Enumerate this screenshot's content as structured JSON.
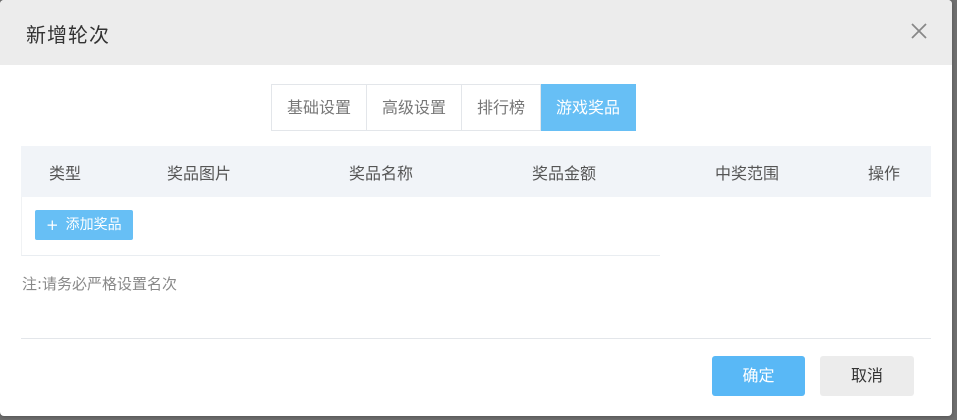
{
  "dialog": {
    "title": "新增轮次"
  },
  "tabs": [
    {
      "label": "基础设置",
      "active": false
    },
    {
      "label": "高级设置",
      "active": false
    },
    {
      "label": "排行榜",
      "active": false
    },
    {
      "label": "游戏奖品",
      "active": true
    }
  ],
  "table": {
    "headers": [
      "类型",
      "奖品图片",
      "奖品名称",
      "奖品金额",
      "中奖范围",
      "操作"
    ],
    "rows": []
  },
  "add_button": {
    "icon": "plus-icon",
    "label": "添加奖品"
  },
  "note": "注:请务必严格设置名次",
  "footer": {
    "confirm_label": "确定",
    "cancel_label": "取消"
  },
  "colors": {
    "accent": "#67bff5",
    "confirm": "#59b8f6",
    "header_bg": "#ececec",
    "table_head_bg": "#f1f4f8"
  }
}
